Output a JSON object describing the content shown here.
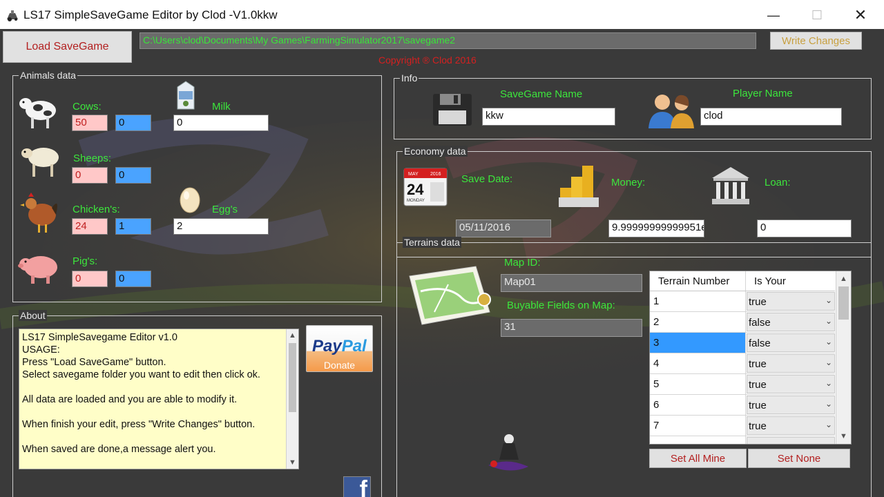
{
  "window": {
    "title": "LS17 SimpleSaveGame Editor by Clod -V1.0kkw",
    "controls": [
      "—",
      "☐",
      "✕"
    ]
  },
  "toolbar": {
    "load_label": "Load SaveGame",
    "path_value": "C:\\Users\\clod\\Documents\\My Games\\FarmingSimulator2017\\savegame2",
    "write_label": "Write Changes",
    "copyright": "Copyright ® Clod 2016"
  },
  "animals": {
    "legend": "Animals data",
    "cows": {
      "label": "Cows:",
      "value": "50",
      "value2": "0"
    },
    "milk": {
      "label": "Milk",
      "value": "0"
    },
    "sheeps": {
      "label": "Sheeps:",
      "value": "0",
      "value2": "0"
    },
    "chickens": {
      "label": "Chicken's:",
      "value": "24",
      "value2": "1"
    },
    "eggs": {
      "label": "Egg's",
      "value": "2"
    },
    "pigs": {
      "label": "Pig's:",
      "value": "0",
      "value2": "0"
    }
  },
  "info": {
    "legend": "Info",
    "savegame_label": "SaveGame Name",
    "savegame_value": "kkw",
    "player_label": "Player Name",
    "player_value": "clod"
  },
  "economy": {
    "legend": "Economy data",
    "calendar_month": "MAY",
    "calendar_year": "2016",
    "calendar_day": "24",
    "calendar_weekday": "MONDAY",
    "date_label": "Save Date:",
    "date_value": "05/11/2016",
    "money_label": "Money:",
    "money_value": "9.99999999999951e",
    "loan_label": "Loan:",
    "loan_value": "0"
  },
  "terrains": {
    "legend": "Terrains data",
    "mapid_label": "Map ID:",
    "mapid_value": "Map01",
    "fields_label": "Buyable Fields on Map:",
    "fields_value": "31",
    "columns": [
      "Terrain Number",
      "Is Your"
    ],
    "rows": [
      {
        "num": "1",
        "own": "true"
      },
      {
        "num": "2",
        "own": "false"
      },
      {
        "num": "3",
        "own": "false"
      },
      {
        "num": "4",
        "own": "true"
      },
      {
        "num": "5",
        "own": "true"
      },
      {
        "num": "6",
        "own": "true"
      },
      {
        "num": "7",
        "own": "true"
      }
    ],
    "selected_row": 2,
    "set_all_label": "Set All Mine",
    "set_none_label": "Set None"
  },
  "about": {
    "legend": "About",
    "lines": [
      "LS17 SimpleSavegame Editor v1.0",
      "",
      "USAGE:",
      "Press \"Load SaveGame\" button.",
      "Select savegame folder you want to edit then click ok.",
      "",
      "All data are loaded and you are able to modify it.",
      "",
      "When finish your edit, press \"Write Changes\" button.",
      "",
      "When saved are done,a message alert you."
    ],
    "paypal_word1": "Pay",
    "paypal_word2": "Pal",
    "paypal_donate": "Donate",
    "facebook_letter": "f"
  },
  "colors": {
    "label_green": "#3ce63c",
    "accent_red": "#d42020",
    "selection_blue": "#3399ff",
    "form_background": "#3a3a3a"
  }
}
